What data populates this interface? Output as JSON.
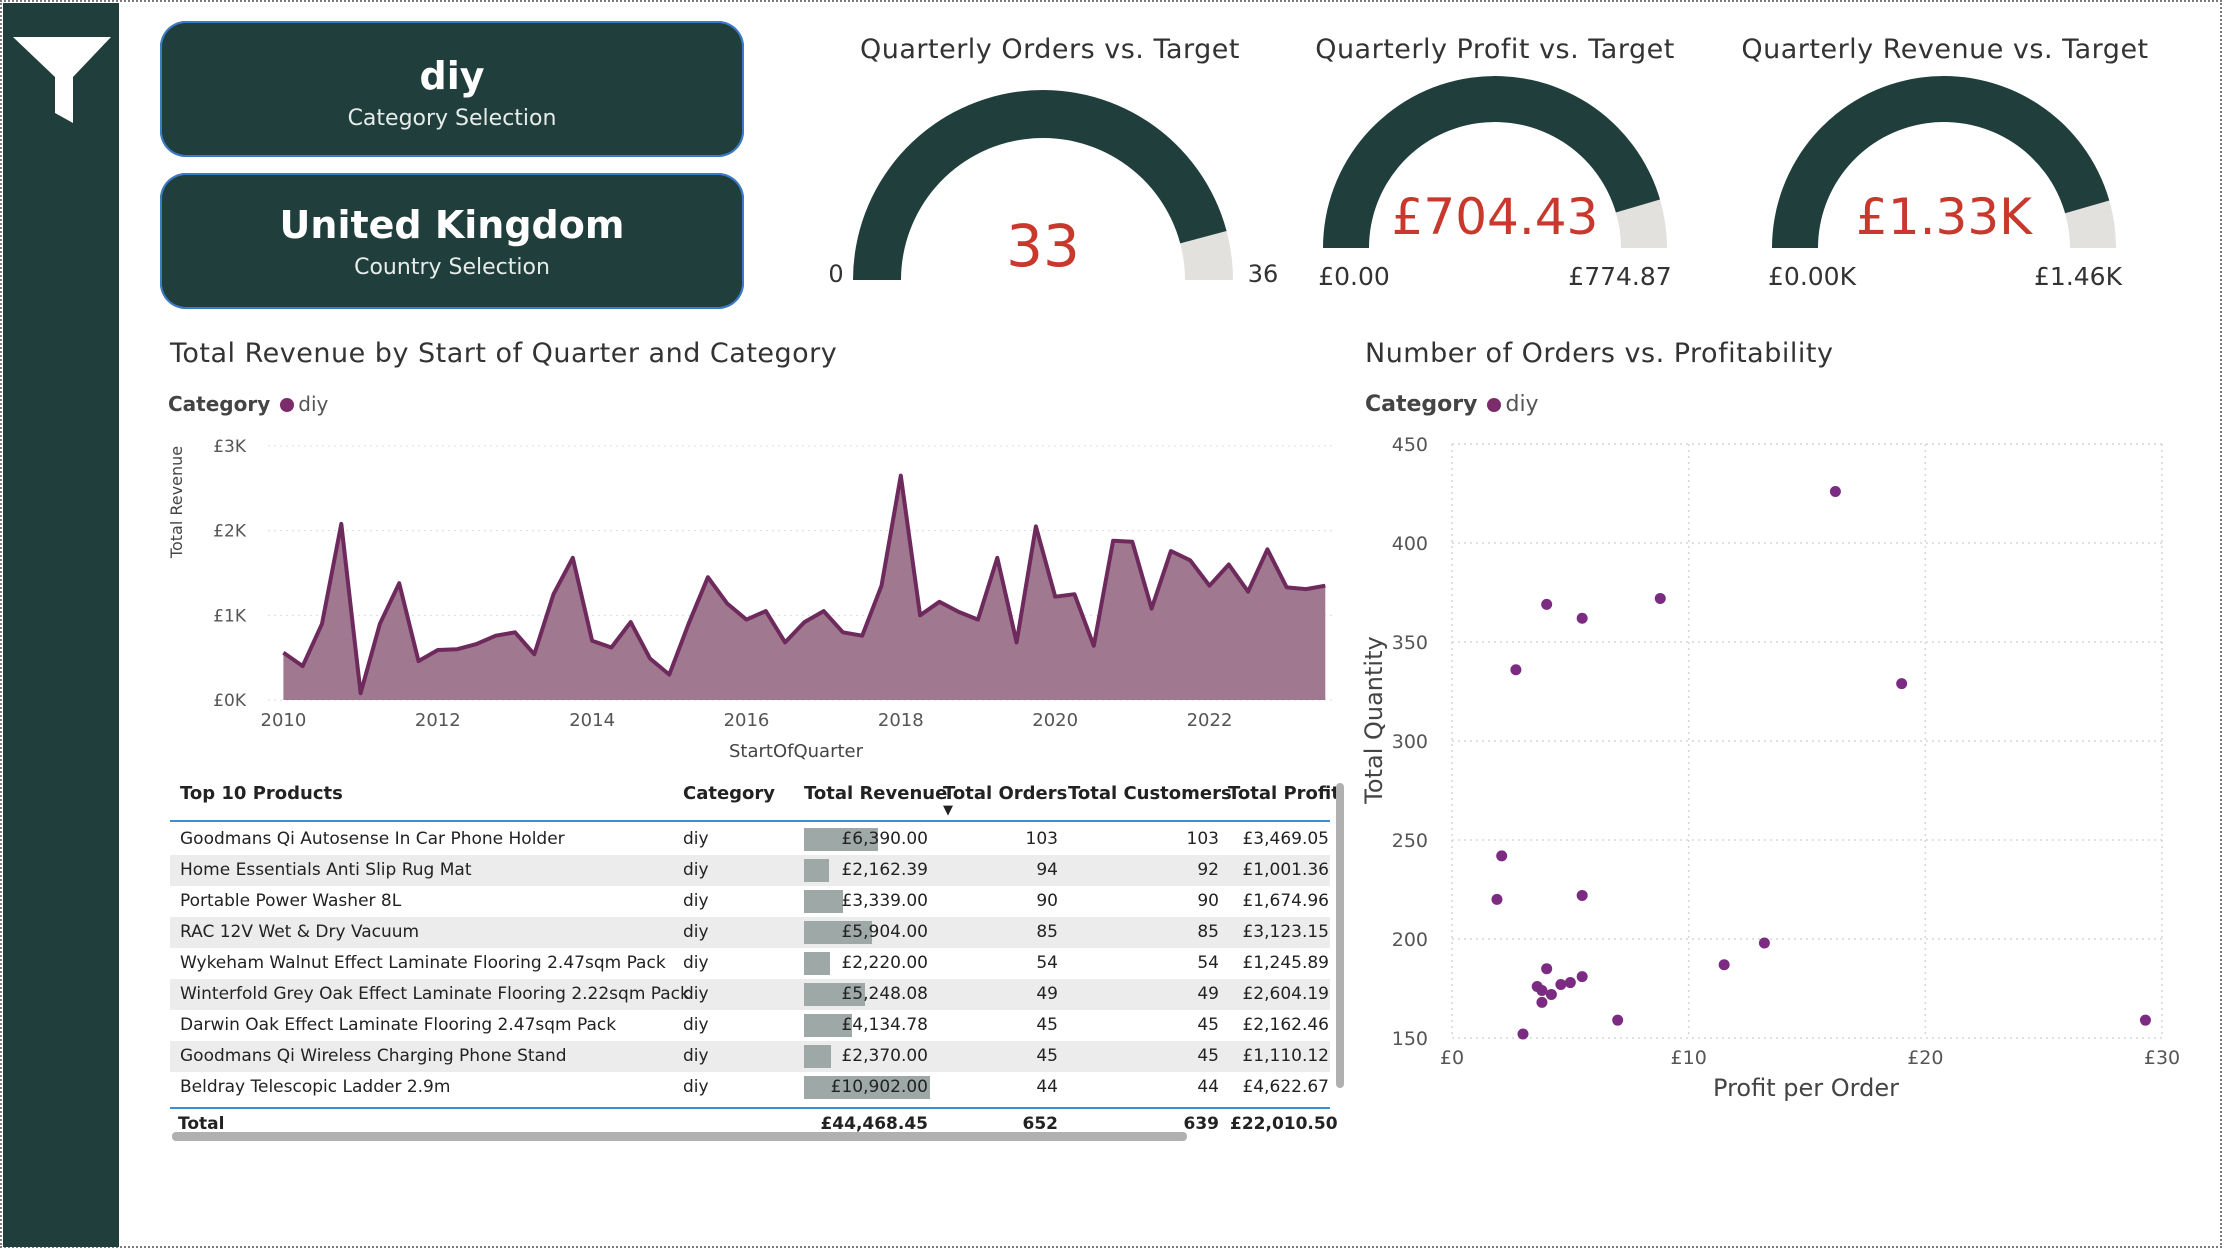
{
  "cards": [
    {
      "value": "diy",
      "label": "Category Selection"
    },
    {
      "value": "United Kingdom",
      "label": "Country Selection"
    }
  ],
  "gauges": [
    {
      "title": "Quarterly Orders vs. Target",
      "value_label": "33",
      "min_label": "0",
      "max_label": "36",
      "fraction": 0.917
    },
    {
      "title": "Quarterly Profit vs. Target",
      "value_label": "£704.43",
      "min_label": "£0.00",
      "max_label": "£774.87",
      "fraction": 0.909
    },
    {
      "title": "Quarterly Revenue vs. Target",
      "value_label": "£1.33K",
      "min_label": "£0.00K",
      "max_label": "£1.46K",
      "fraction": 0.911
    }
  ],
  "colors": {
    "accent": "#203f3c",
    "gauge_fill": "#203f3c",
    "gauge_rest": "#e3e1de",
    "gauge_value": "#c8382c",
    "series": "#6e2a5c",
    "area": "#a07890",
    "scatter": "#7b2c82",
    "table_bar": "#9ea8a6"
  },
  "revenue_chart": {
    "title": "Total Revenue by Start of Quarter and Category",
    "legend_title": "Category",
    "legend_item": "diy",
    "xlabel": "StartOfQuarter",
    "ylabel": "Total Revenue"
  },
  "scatter_chart": {
    "title": "Number of Orders vs. Profitability",
    "legend_title": "Category",
    "legend_item": "diy",
    "xlabel": "Profit per Order",
    "ylabel": "Total Quantity"
  },
  "chart_data": [
    {
      "type": "area",
      "title": "Total Revenue by Start of Quarter and Category",
      "xlabel": "StartOfQuarter",
      "ylabel": "Total Revenue",
      "series": [
        {
          "name": "diy",
          "x": [
            2010.0,
            2010.25,
            2010.5,
            2010.75,
            2011.0,
            2011.25,
            2011.5,
            2011.75,
            2012.0,
            2012.25,
            2012.5,
            2012.75,
            2013.0,
            2013.25,
            2013.5,
            2013.75,
            2014.0,
            2014.25,
            2014.5,
            2014.75,
            2015.0,
            2015.25,
            2015.5,
            2015.75,
            2016.0,
            2016.25,
            2016.5,
            2016.75,
            2017.0,
            2017.25,
            2017.5,
            2017.75,
            2018.0,
            2018.25,
            2018.5,
            2018.75,
            2019.0,
            2019.25,
            2019.5,
            2019.75,
            2020.0,
            2020.25,
            2020.5,
            2020.75,
            2021.0,
            2021.25,
            2021.5,
            2021.75,
            2022.0,
            2022.25,
            2022.5,
            2022.75,
            2023.0,
            2023.25,
            2023.5
          ],
          "values": [
            560,
            400,
            900,
            2080,
            80,
            900,
            1380,
            460,
            590,
            600,
            660,
            760,
            800,
            540,
            1250,
            1680,
            700,
            620,
            920,
            490,
            300,
            900,
            1450,
            1140,
            950,
            1050,
            680,
            920,
            1050,
            800,
            760,
            1350,
            2650,
            1000,
            1160,
            1040,
            950,
            1680,
            680,
            2050,
            1220,
            1250,
            640,
            1880,
            1870,
            1080,
            1760,
            1650,
            1350,
            1600,
            1280,
            1780,
            1330,
            1310,
            1350
          ]
        }
      ],
      "xlim": [
        2009.8,
        2023.6
      ],
      "ylim": [
        0,
        3000
      ],
      "y_ticks": [
        "£0K",
        "£1K",
        "£2K",
        "£3K"
      ],
      "x_ticks": [
        "2010",
        "2012",
        "2014",
        "2016",
        "2018",
        "2020",
        "2022"
      ],
      "legend": "top-left"
    },
    {
      "type": "scatter",
      "title": "Number of Orders vs. Profitability",
      "xlabel": "Profit per Order",
      "ylabel": "Total Quantity",
      "series": [
        {
          "name": "diy",
          "x": [
            2.7,
            4.0,
            5.5,
            8.8,
            16.2,
            19.0,
            2.1,
            1.9,
            5.5,
            4.0,
            3.6,
            3.8,
            4.2,
            4.6,
            5.0,
            5.5,
            3.8,
            3.0,
            7.0,
            11.5,
            13.2,
            29.3
          ],
          "y": [
            336,
            369,
            362,
            372,
            426,
            329,
            242,
            220,
            222,
            185,
            176,
            174,
            172,
            177,
            178,
            181,
            168,
            152,
            159,
            187,
            198,
            159
          ]
        }
      ],
      "xlim": [
        0,
        30
      ],
      "ylim": [
        150,
        450
      ],
      "x_ticks": [
        "£0",
        "£10",
        "£20",
        "£30"
      ],
      "y_ticks": [
        "150",
        "200",
        "250",
        "300",
        "350",
        "400",
        "450"
      ],
      "grid": true,
      "legend": "top-left"
    }
  ],
  "table": {
    "headers": [
      "Top 10 Products",
      "Category",
      "Total Revenue",
      "Total Orders",
      "Total Customers",
      "Total Profit"
    ],
    "sort_indicator": "▼",
    "rows": [
      {
        "product": "Goodmans Qi Autosense In Car Phone Holder",
        "category": "diy",
        "revenue": "£6,390.00",
        "revenue_fraction": 0.586,
        "orders": "103",
        "customers": "103",
        "profit": "£3,469.05"
      },
      {
        "product": "Home Essentials Anti Slip Rug Mat",
        "category": "diy",
        "revenue": "£2,162.39",
        "revenue_fraction": 0.198,
        "orders": "94",
        "customers": "92",
        "profit": "£1,001.36"
      },
      {
        "product": "Portable Power Washer 8L",
        "category": "diy",
        "revenue": "£3,339.00",
        "revenue_fraction": 0.306,
        "orders": "90",
        "customers": "90",
        "profit": "£1,674.96"
      },
      {
        "product": "RAC 12V Wet & Dry Vacuum",
        "category": "diy",
        "revenue": "£5,904.00",
        "revenue_fraction": 0.542,
        "orders": "85",
        "customers": "85",
        "profit": "£3,123.15"
      },
      {
        "product": "Wykeham Walnut Effect Laminate Flooring 2.47sqm Pack",
        "category": "diy",
        "revenue": "£2,220.00",
        "revenue_fraction": 0.204,
        "orders": "54",
        "customers": "54",
        "profit": "£1,245.89"
      },
      {
        "product": "Winterfold Grey Oak Effect Laminate Flooring 2.22sqm Pack",
        "category": "diy",
        "revenue": "£5,248.08",
        "revenue_fraction": 0.481,
        "orders": "49",
        "customers": "49",
        "profit": "£2,604.19"
      },
      {
        "product": "Darwin Oak Effect Laminate Flooring 2.47sqm Pack",
        "category": "diy",
        "revenue": "£4,134.78",
        "revenue_fraction": 0.379,
        "orders": "45",
        "customers": "45",
        "profit": "£2,162.46"
      },
      {
        "product": "Goodmans Qi Wireless Charging Phone Stand",
        "category": "diy",
        "revenue": "£2,370.00",
        "revenue_fraction": 0.217,
        "orders": "45",
        "customers": "45",
        "profit": "£1,110.12"
      },
      {
        "product": "Beldray Telescopic Ladder 2.9m",
        "category": "diy",
        "revenue": "£10,902.00",
        "revenue_fraction": 1.0,
        "orders": "44",
        "customers": "44",
        "profit": "£4,622.67"
      }
    ],
    "total": {
      "label": "Total",
      "revenue": "£44,468.45",
      "orders": "652",
      "customers": "639",
      "profit": "£22,010.50"
    }
  }
}
